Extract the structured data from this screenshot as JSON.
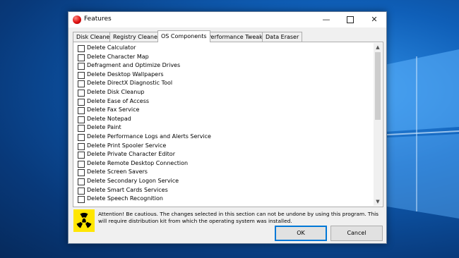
{
  "window": {
    "title": "Features",
    "icon": "app-icon",
    "controls": {
      "minimize": "—",
      "close": "✕"
    }
  },
  "tabs": [
    {
      "label": "Disk Cleaner",
      "active": false
    },
    {
      "label": "Registry Cleaner",
      "active": false
    },
    {
      "label": "OS Components",
      "active": true
    },
    {
      "label": "Performance Tweaks",
      "active": false
    },
    {
      "label": "Data Eraser",
      "active": false
    }
  ],
  "components": [
    "Delete Calculator",
    "Delete Character Map",
    "Defragment and Optimize Drives",
    "Delete Desktop Wallpapers",
    "Delete DirectX Diagnostic Tool",
    "Delete Disk Cleanup",
    "Delete Ease of Access",
    "Delete Fax Service",
    "Delete Notepad",
    "Delete Paint",
    "Delete Performance Logs and Alerts Service",
    "Delete Print Spooler Service",
    "Delete Private Character Editor",
    "Delete Remote Desktop Connection",
    "Delete Screen Savers",
    "Delete Secondary Logon Service",
    "Delete Smart Cards Services",
    "Delete Speech Recognition"
  ],
  "scroll": {
    "up": "▲",
    "down": "▼"
  },
  "warning": {
    "icon": "radiation-hazard-icon",
    "text": "Attention! Be cautious. The changes selected in this section can not be undone by using this program. This will require distribution kit from which the operating system was installed."
  },
  "buttons": {
    "ok": "OK",
    "cancel": "Cancel"
  },
  "colors": {
    "accent": "#0078d7",
    "hazard": "#ffe600"
  }
}
